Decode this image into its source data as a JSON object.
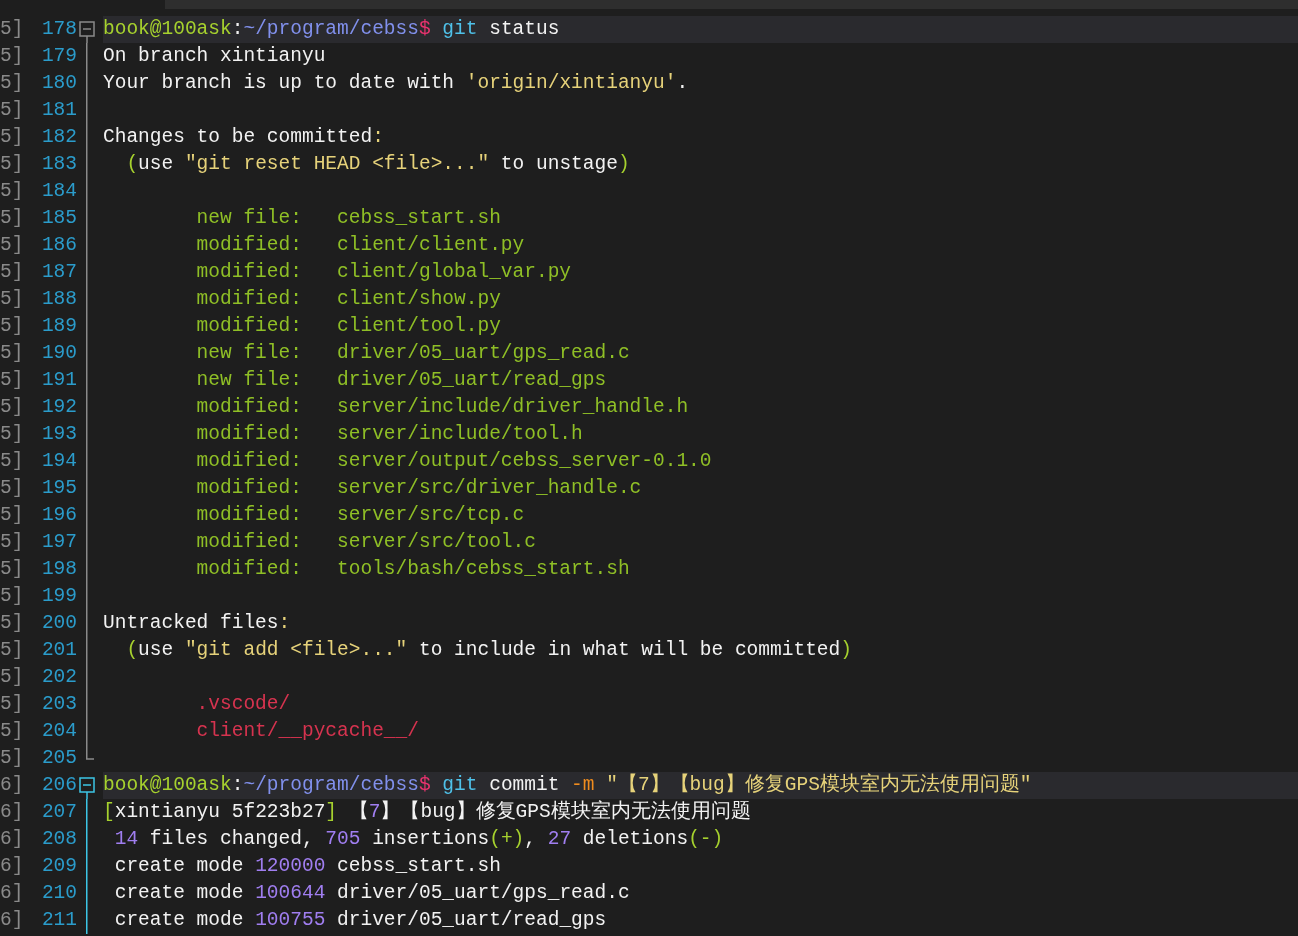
{
  "lines": [
    {
      "gutter": "5]",
      "number": "178",
      "kind": "fold-start",
      "active": false,
      "highlighted": true,
      "segments": [
        {
          "text": "book@100ask",
          "kind": "user"
        },
        {
          "text": ":",
          "kind": "plain"
        },
        {
          "text": "~/program/cebss",
          "kind": "path"
        },
        {
          "text": "$",
          "kind": "dollar"
        },
        {
          "text": " git",
          "kind": "command"
        },
        {
          "text": " status",
          "kind": "plain"
        }
      ]
    },
    {
      "gutter": "5]",
      "number": "179",
      "kind": "fold-body",
      "active": false,
      "highlighted": false,
      "segments": [
        {
          "text": "On branch xintianyu",
          "kind": "plain"
        }
      ]
    },
    {
      "gutter": "5]",
      "number": "180",
      "kind": "fold-body",
      "active": false,
      "highlighted": false,
      "segments": [
        {
          "text": "Your branch is up to date with ",
          "kind": "plain"
        },
        {
          "text": "'origin/xintianyu'",
          "kind": "string"
        },
        {
          "text": ".",
          "kind": "plain"
        }
      ]
    },
    {
      "gutter": "5]",
      "number": "181",
      "kind": "fold-body",
      "active": false,
      "highlighted": false
    },
    {
      "gutter": "5]",
      "number": "182",
      "kind": "fold-body",
      "active": false,
      "highlighted": false,
      "segments": [
        {
          "text": "Changes to be committed",
          "kind": "plain"
        },
        {
          "text": ":",
          "kind": "string"
        }
      ]
    },
    {
      "gutter": "5]",
      "number": "183",
      "kind": "fold-body",
      "active": false,
      "highlighted": false,
      "segments": [
        {
          "text": "  (",
          "kind": "paren"
        },
        {
          "text": "use ",
          "kind": "plain"
        },
        {
          "text": "\"git reset HEAD <file>...\"",
          "kind": "string"
        },
        {
          "text": " to unstage",
          "kind": "plain"
        },
        {
          "text": ")",
          "kind": "paren"
        }
      ]
    },
    {
      "gutter": "5]",
      "number": "184",
      "kind": "fold-body",
      "active": false,
      "highlighted": false
    },
    {
      "gutter": "5]",
      "number": "185",
      "kind": "fold-body",
      "active": false,
      "highlighted": false,
      "segments": [
        {
          "text": "        new file:   cebss_start.sh",
          "kind": "staged"
        }
      ]
    },
    {
      "gutter": "5]",
      "number": "186",
      "kind": "fold-body",
      "active": false,
      "highlighted": false,
      "segments": [
        {
          "text": "        modified:   client/client.py",
          "kind": "staged"
        }
      ]
    },
    {
      "gutter": "5]",
      "number": "187",
      "kind": "fold-body",
      "active": false,
      "highlighted": false,
      "segments": [
        {
          "text": "        modified:   client/global_var.py",
          "kind": "staged"
        }
      ]
    },
    {
      "gutter": "5]",
      "number": "188",
      "kind": "fold-body",
      "active": false,
      "highlighted": false,
      "segments": [
        {
          "text": "        modified:   client/show.py",
          "kind": "staged"
        }
      ]
    },
    {
      "gutter": "5]",
      "number": "189",
      "kind": "fold-body",
      "active": false,
      "highlighted": false,
      "segments": [
        {
          "text": "        modified:   client/tool.py",
          "kind": "staged"
        }
      ]
    },
    {
      "gutter": "5]",
      "number": "190",
      "kind": "fold-body",
      "active": false,
      "highlighted": false,
      "segments": [
        {
          "text": "        new file:   driver/05_uart/gps_read.c",
          "kind": "staged"
        }
      ]
    },
    {
      "gutter": "5]",
      "number": "191",
      "kind": "fold-body",
      "active": false,
      "highlighted": false,
      "segments": [
        {
          "text": "        new file:   driver/05_uart/read_gps",
          "kind": "staged"
        }
      ]
    },
    {
      "gutter": "5]",
      "number": "192",
      "kind": "fold-body",
      "active": false,
      "highlighted": false,
      "segments": [
        {
          "text": "        modified:   server/include/driver_handle.h",
          "kind": "staged"
        }
      ]
    },
    {
      "gutter": "5]",
      "number": "193",
      "kind": "fold-body",
      "active": false,
      "highlighted": false,
      "segments": [
        {
          "text": "        modified:   server/include/tool.h",
          "kind": "staged"
        }
      ]
    },
    {
      "gutter": "5]",
      "number": "194",
      "kind": "fold-body",
      "active": false,
      "highlighted": false,
      "segments": [
        {
          "text": "        modified:   server/output/cebss_server-0.1.0",
          "kind": "staged"
        }
      ]
    },
    {
      "gutter": "5]",
      "number": "195",
      "kind": "fold-body",
      "active": false,
      "highlighted": false,
      "segments": [
        {
          "text": "        modified:   server/src/driver_handle.c",
          "kind": "staged"
        }
      ]
    },
    {
      "gutter": "5]",
      "number": "196",
      "kind": "fold-body",
      "active": false,
      "highlighted": false,
      "segments": [
        {
          "text": "        modified:   server/src/tcp.c",
          "kind": "staged"
        }
      ]
    },
    {
      "gutter": "5]",
      "number": "197",
      "kind": "fold-body",
      "active": false,
      "highlighted": false,
      "segments": [
        {
          "text": "        modified:   server/src/tool.c",
          "kind": "staged"
        }
      ]
    },
    {
      "gutter": "5]",
      "number": "198",
      "kind": "fold-body",
      "active": false,
      "highlighted": false,
      "segments": [
        {
          "text": "        modified:   tools/bash/cebss_start.sh",
          "kind": "staged"
        }
      ]
    },
    {
      "gutter": "5]",
      "number": "199",
      "kind": "fold-body",
      "active": false,
      "highlighted": false
    },
    {
      "gutter": "5]",
      "number": "200",
      "kind": "fold-body",
      "active": false,
      "highlighted": false,
      "segments": [
        {
          "text": "Untracked files",
          "kind": "plain"
        },
        {
          "text": ":",
          "kind": "string"
        }
      ]
    },
    {
      "gutter": "5]",
      "number": "201",
      "kind": "fold-body",
      "active": false,
      "highlighted": false,
      "segments": [
        {
          "text": "  (",
          "kind": "paren"
        },
        {
          "text": "use ",
          "kind": "plain"
        },
        {
          "text": "\"git add <file>...\"",
          "kind": "string"
        },
        {
          "text": " to include in what will be committed",
          "kind": "plain"
        },
        {
          "text": ")",
          "kind": "paren"
        }
      ]
    },
    {
      "gutter": "5]",
      "number": "202",
      "kind": "fold-body",
      "active": false,
      "highlighted": false
    },
    {
      "gutter": "5]",
      "number": "203",
      "kind": "fold-body",
      "active": false,
      "highlighted": false,
      "segments": [
        {
          "text": "        .vscode/",
          "kind": "untracked"
        }
      ]
    },
    {
      "gutter": "5]",
      "number": "204",
      "kind": "fold-body",
      "active": false,
      "highlighted": false,
      "segments": [
        {
          "text": "        client/__pycache__/",
          "kind": "untracked"
        }
      ]
    },
    {
      "gutter": "5]",
      "number": "205",
      "kind": "fold-end",
      "active": false,
      "highlighted": false
    },
    {
      "gutter": "6]",
      "number": "206",
      "kind": "fold-start",
      "active": true,
      "highlighted": true,
      "segments": [
        {
          "text": "book@100ask",
          "kind": "user"
        },
        {
          "text": ":",
          "kind": "plain"
        },
        {
          "text": "~/program/cebss",
          "kind": "path"
        },
        {
          "text": "$",
          "kind": "dollar"
        },
        {
          "text": " git",
          "kind": "command"
        },
        {
          "text": " commit ",
          "kind": "plain"
        },
        {
          "text": "-m",
          "kind": "flag"
        },
        {
          "text": " \"【7】【bug】修复GPS模块室内无法使用问题\"",
          "kind": "string"
        }
      ]
    },
    {
      "gutter": "6]",
      "number": "207",
      "kind": "fold-body",
      "active": true,
      "highlighted": false,
      "segments": [
        {
          "text": "[",
          "kind": "paren"
        },
        {
          "text": "xintianyu 5f223b27",
          "kind": "plain"
        },
        {
          "text": "]",
          "kind": "paren"
        },
        {
          "text": " 【",
          "kind": "plain"
        },
        {
          "text": "7",
          "kind": "number"
        },
        {
          "text": "】【bug】修复GPS模块室内无法使用问题",
          "kind": "plain"
        }
      ]
    },
    {
      "gutter": "6]",
      "number": "208",
      "kind": "fold-body",
      "active": true,
      "highlighted": false,
      "segments": [
        {
          "text": " 14",
          "kind": "number"
        },
        {
          "text": " files changed, ",
          "kind": "plain"
        },
        {
          "text": "705",
          "kind": "number"
        },
        {
          "text": " insertions",
          "kind": "plain"
        },
        {
          "text": "(+)",
          "kind": "paren"
        },
        {
          "text": ", ",
          "kind": "plain"
        },
        {
          "text": "27",
          "kind": "number"
        },
        {
          "text": " deletions",
          "kind": "plain"
        },
        {
          "text": "(-)",
          "kind": "paren"
        }
      ]
    },
    {
      "gutter": "6]",
      "number": "209",
      "kind": "fold-body",
      "active": true,
      "highlighted": false,
      "segments": [
        {
          "text": " create mode ",
          "kind": "plain"
        },
        {
          "text": "120000",
          "kind": "number"
        },
        {
          "text": " cebss_start.sh",
          "kind": "plain"
        }
      ]
    },
    {
      "gutter": "6]",
      "number": "210",
      "kind": "fold-body",
      "active": true,
      "highlighted": false,
      "segments": [
        {
          "text": " create mode ",
          "kind": "plain"
        },
        {
          "text": "100644",
          "kind": "number"
        },
        {
          "text": " driver/05_uart/gps_read.c",
          "kind": "plain"
        }
      ]
    },
    {
      "gutter": "6]",
      "number": "211",
      "kind": "fold-body",
      "active": true,
      "highlighted": false,
      "segments": [
        {
          "text": " create mode ",
          "kind": "plain"
        },
        {
          "text": "100755",
          "kind": "number"
        },
        {
          "text": " driver/05_uart/read_gps",
          "kind": "plain"
        }
      ]
    }
  ]
}
